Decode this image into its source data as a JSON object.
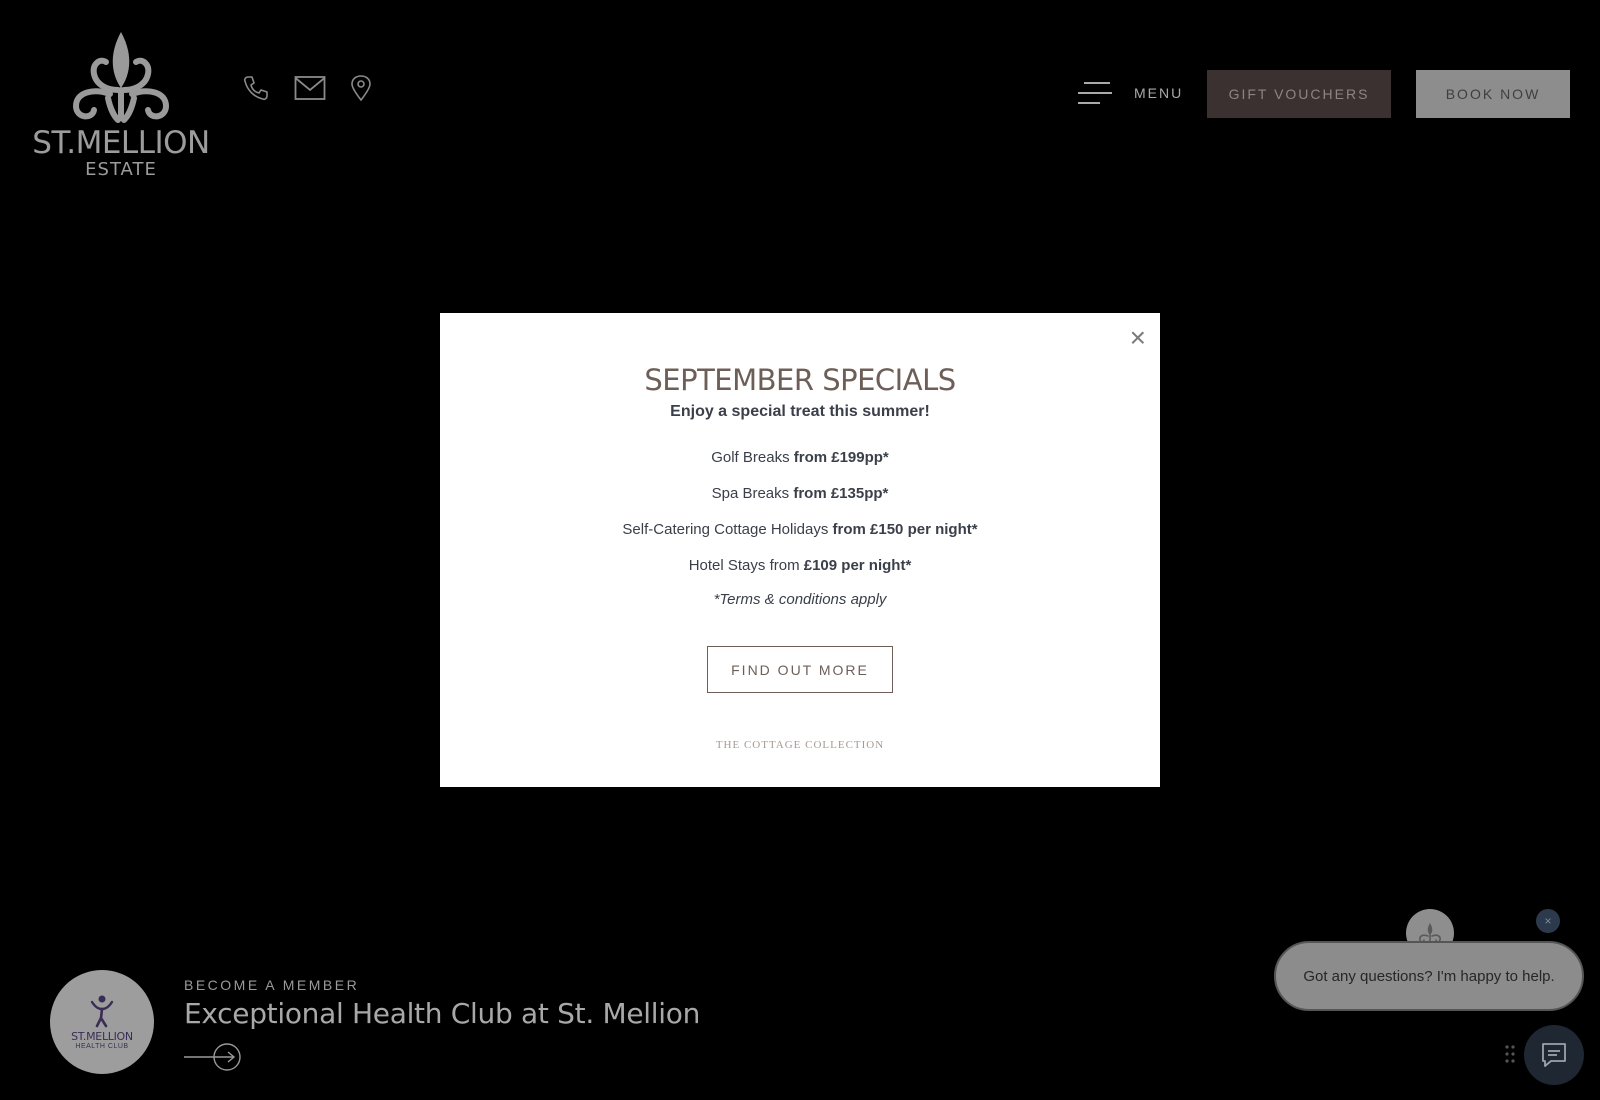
{
  "header": {
    "logo": {
      "name": "ST.MELLION",
      "sub": "ESTATE"
    },
    "menu_label": "MENU",
    "gift_label": "GIFT VOUCHERS",
    "book_label": "BOOK NOW",
    "contact_icons": [
      "phone-icon",
      "mail-icon",
      "location-pin-icon"
    ]
  },
  "modal": {
    "close_glyph": "×",
    "title": "SEPTEMBER SPECIALS",
    "subtitle": "Enjoy a special treat this summer!",
    "offers": [
      {
        "label": "Golf Breaks ",
        "price": "from £199pp*"
      },
      {
        "label": "Spa Breaks ",
        "price": "from £135pp*"
      },
      {
        "label": "Self-Catering Cottage Holidays ",
        "price": "from £150 per night*"
      },
      {
        "label": "Hotel Stays from ",
        "price": "£109 per night*"
      }
    ],
    "terms": "*Terms & conditions apply",
    "cta_label": "FIND OUT MORE",
    "footer_logo": "THE COTTAGE COLLECTION"
  },
  "promo": {
    "badge_name": "ST.MELLION",
    "badge_sub": "HEALTH CLUB",
    "eyebrow": "BECOME A MEMBER",
    "title": "Exceptional Health Club at St. Mellion"
  },
  "chat": {
    "message": "Got any questions? I'm happy to help.",
    "dismiss_glyph": "×"
  },
  "colors": {
    "page_bg": "#000000",
    "modal_bg": "#ffffff",
    "accent_brown": "#6d5f58",
    "gift_bg": "#3a3130",
    "book_bg": "#8d8d8d"
  }
}
